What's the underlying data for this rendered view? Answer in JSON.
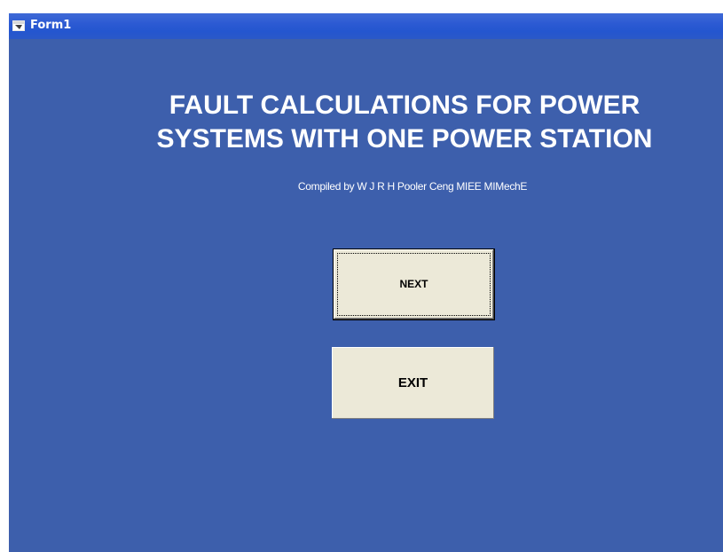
{
  "window": {
    "title": "Form1",
    "icon": "form-window-icon"
  },
  "main": {
    "heading_line1": "FAULT CALCULATIONS FOR POWER",
    "heading_line2": "SYSTEMS WITH ONE POWER STATION",
    "compiled_by": "Compiled by W J R H Pooler Ceng MIEE MIMechE"
  },
  "buttons": {
    "next_label": "NEXT",
    "exit_label": "EXIT"
  },
  "colors": {
    "form_background": "#3d5fac",
    "titlebar": "#2456cf",
    "button_face": "#ece9d8",
    "text_on_form": "#ffffff"
  }
}
